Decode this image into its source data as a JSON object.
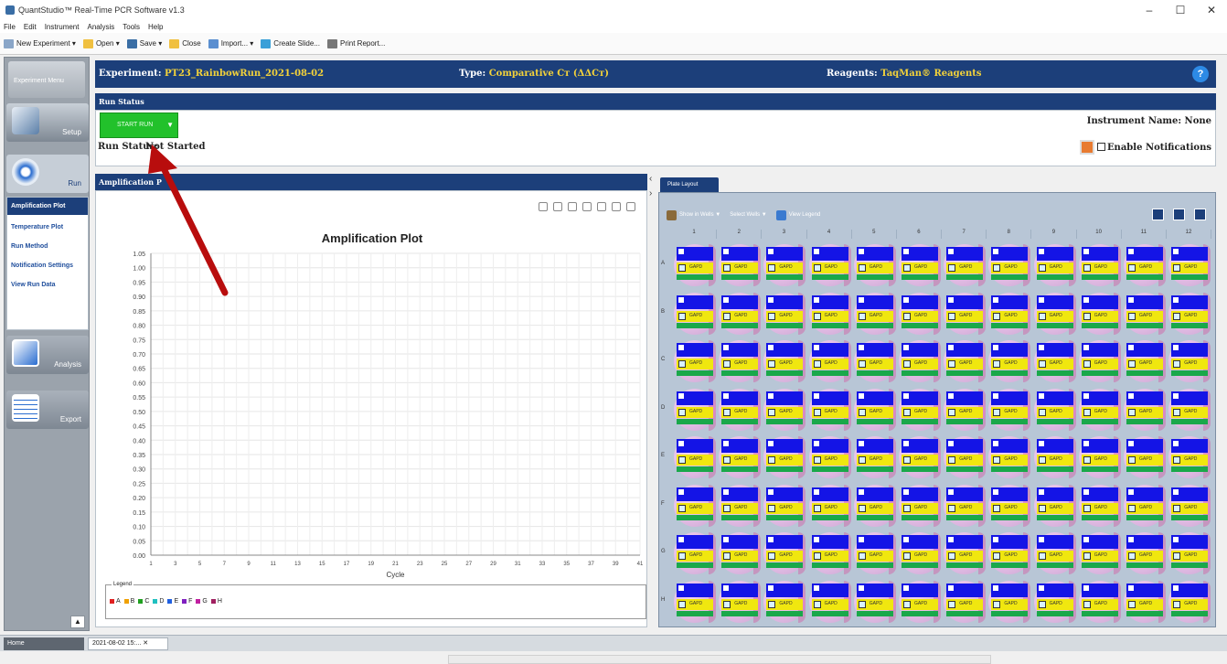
{
  "window": {
    "title": "QuantStudio™ Real-Time PCR Software v1.3",
    "controls": [
      "–",
      "☐",
      "✕"
    ]
  },
  "menu": [
    "File",
    "Edit",
    "Instrument",
    "Analysis",
    "Tools",
    "Help"
  ],
  "toolbar": {
    "new_experiment": "New Experiment",
    "open": "Open",
    "save": "Save",
    "close": "Close",
    "import": "Import...",
    "create_slide": "Create Slide...",
    "print_report": "Print Report..."
  },
  "leftnav": {
    "top_label": "Experiment Menu",
    "setup": "Setup",
    "run": "Run",
    "analysis": "Analysis",
    "export": "Export",
    "run_items": [
      "Amplification Plot",
      "Temperature Plot",
      "Run Method",
      "Notification Settings",
      "View Run Data"
    ],
    "scroll_up": "▲"
  },
  "experiment": {
    "label": "Experiment:",
    "name": "PT23_RainbowRun_2021-08-02",
    "type_label": "Type:",
    "type": "Comparative Cт (ΔΔCт)",
    "reagents_label": "Reagents:",
    "reagents": "TaqMan® Reagents",
    "help": "?"
  },
  "run_status": {
    "header": "Run Status",
    "start_button": "START RUN",
    "dropdown": "▼",
    "status_label": "Run Status:",
    "status_value": "Not Started",
    "instrument": "Instrument Name: None",
    "notifications": "Enable Notifications"
  },
  "amplification": {
    "header": "Amplification P",
    "plot_title": "Amplification Plot",
    "legend_title": "Legend",
    "legend": [
      {
        "label": "A",
        "color": "#e02020"
      },
      {
        "label": "B",
        "color": "#f0a000"
      },
      {
        "label": "C",
        "color": "#20a020"
      },
      {
        "label": "D",
        "color": "#20c0c0"
      },
      {
        "label": "E",
        "color": "#2060e0"
      },
      {
        "label": "F",
        "color": "#8020c0"
      },
      {
        "label": "G",
        "color": "#c020a0"
      },
      {
        "label": "H",
        "color": "#a02060"
      }
    ]
  },
  "chart_data": {
    "type": "line",
    "title": "Amplification Plot",
    "xlabel": "Cycle",
    "ylabel": "",
    "x_ticks": [
      "1",
      "3",
      "5",
      "7",
      "9",
      "11",
      "13",
      "15",
      "17",
      "19",
      "21",
      "23",
      "25",
      "27",
      "29",
      "31",
      "33",
      "35",
      "37",
      "39",
      "41"
    ],
    "y_ticks": [
      "1.05",
      "1.00",
      "0.95",
      "0.90",
      "0.85",
      "0.80",
      "0.75",
      "0.70",
      "0.65",
      "0.60",
      "0.55",
      "0.50",
      "0.45",
      "0.40",
      "0.35",
      "0.30",
      "0.25",
      "0.20",
      "0.15",
      "0.10",
      "0.05",
      "0.00"
    ],
    "ylim": [
      0,
      1.05
    ],
    "grid": true,
    "series": []
  },
  "plate": {
    "tab": "Plate Layout",
    "show_in_wells": "Show in Wells",
    "select_wells": "Select Wells",
    "view_legend": "View Legend",
    "columns": [
      "1",
      "2",
      "3",
      "4",
      "5",
      "6",
      "7",
      "8",
      "9",
      "10",
      "11",
      "12"
    ],
    "rows": [
      "A",
      "B",
      "C",
      "D",
      "E",
      "F",
      "G",
      "H"
    ],
    "well_text": "GAPD"
  },
  "bottom": {
    "home": "Home",
    "doc": "2021-08-02 15:... ✕"
  }
}
